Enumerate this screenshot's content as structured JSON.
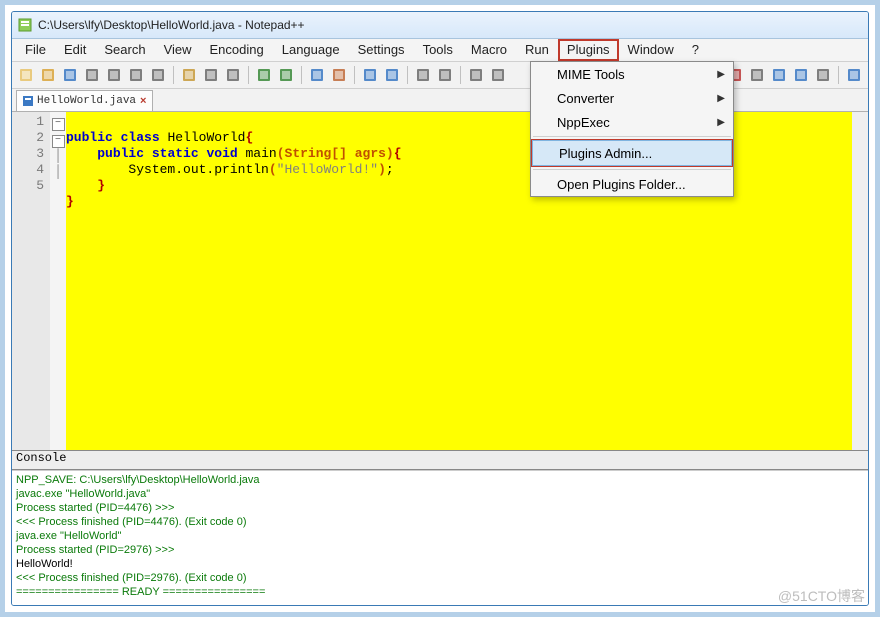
{
  "window": {
    "title": "C:\\Users\\lfy\\Desktop\\HelloWorld.java - Notepad++"
  },
  "menu": {
    "items": [
      {
        "label": "File"
      },
      {
        "label": "Edit"
      },
      {
        "label": "Search"
      },
      {
        "label": "View"
      },
      {
        "label": "Encoding"
      },
      {
        "label": "Language"
      },
      {
        "label": "Settings"
      },
      {
        "label": "Tools"
      },
      {
        "label": "Macro"
      },
      {
        "label": "Run"
      },
      {
        "label": "Plugins",
        "open": true,
        "highlight": true
      },
      {
        "label": "Window"
      },
      {
        "label": "?"
      }
    ]
  },
  "dropdown": {
    "items": [
      {
        "label": "MIME Tools",
        "submenu": true
      },
      {
        "label": "Converter",
        "submenu": true
      },
      {
        "label": "NppExec",
        "submenu": true
      },
      {
        "sep": true
      },
      {
        "label": "Plugins Admin...",
        "highlight": true,
        "hover": true
      },
      {
        "sep": true
      },
      {
        "label": "Open Plugins Folder..."
      }
    ]
  },
  "tab": {
    "name": "HelloWorld.java"
  },
  "code": {
    "lines": [
      "1",
      "2",
      "3",
      "4",
      "5"
    ],
    "l1": {
      "kw1": "public",
      "kw2": "class",
      "nm": "HelloWorld",
      "br": "{"
    },
    "l2": {
      "kw1": "public",
      "kw2": "static",
      "kw3": "void",
      "nm": "main",
      "p": "(String[] agrs)",
      "br": "{"
    },
    "l3": {
      "call": "System.out.println",
      "p": "(",
      "str": "\"HelloWorld!\"",
      "p2": ")",
      "sc": ";"
    },
    "l4": {
      "br": "}"
    },
    "l5": {
      "br": "}"
    }
  },
  "console": {
    "title": "Console",
    "lines": [
      {
        "cls": "cg",
        "t": "NPP_SAVE: C:\\Users\\lfy\\Desktop\\HelloWorld.java"
      },
      {
        "cls": "cg",
        "t": "javac.exe \"HelloWorld.java\""
      },
      {
        "cls": "cg",
        "t": "Process started (PID=4476) >>>"
      },
      {
        "cls": "cg",
        "t": "<<< Process finished (PID=4476). (Exit code 0)"
      },
      {
        "cls": "cg",
        "t": "java.exe \"HelloWorld\""
      },
      {
        "cls": "cg",
        "t": "Process started (PID=2976) >>>"
      },
      {
        "cls": "ck",
        "t": "HelloWorld!"
      },
      {
        "cls": "cg",
        "t": "<<< Process finished (PID=2976). (Exit code 0)"
      },
      {
        "cls": "cg",
        "t": "================ READY ================"
      }
    ]
  },
  "toolbar_icons": [
    {
      "n": "new-file-icon",
      "c": "#e7c36a"
    },
    {
      "n": "open-file-icon",
      "c": "#d9a43b"
    },
    {
      "n": "save-icon",
      "c": "#3a78c3"
    },
    {
      "n": "save-all-icon",
      "c": "#6a6a6a"
    },
    {
      "n": "close-icon",
      "c": "#6a6a6a"
    },
    {
      "n": "close-all-icon",
      "c": "#6a6a6a"
    },
    {
      "n": "print-icon",
      "c": "#6a6a6a"
    },
    {
      "sep": true
    },
    {
      "n": "cut-icon",
      "c": "#c79a3a"
    },
    {
      "n": "copy-icon",
      "c": "#6a6a6a"
    },
    {
      "n": "paste-icon",
      "c": "#6a6a6a"
    },
    {
      "sep": true
    },
    {
      "n": "undo-icon",
      "c": "#3a8a3a"
    },
    {
      "n": "redo-icon",
      "c": "#3a8a3a"
    },
    {
      "sep": true
    },
    {
      "n": "find-icon",
      "c": "#3a78c3"
    },
    {
      "n": "replace-icon",
      "c": "#c06a3a"
    },
    {
      "sep": true
    },
    {
      "n": "zoom-in-icon",
      "c": "#3a78c3"
    },
    {
      "n": "zoom-out-icon",
      "c": "#3a78c3"
    },
    {
      "sep": true
    },
    {
      "n": "sync-v-icon",
      "c": "#6a6a6a"
    },
    {
      "n": "sync-h-icon",
      "c": "#6a6a6a"
    },
    {
      "sep": true
    },
    {
      "n": "wrap-icon",
      "c": "#6a6a6a"
    },
    {
      "n": "chars-icon",
      "c": "#6a6a6a"
    },
    {
      "gap": true
    },
    {
      "n": "record-icon",
      "c": "#c03a3a"
    },
    {
      "n": "stop-icon",
      "c": "#6a6a6a"
    },
    {
      "n": "play-icon",
      "c": "#3a78c3"
    },
    {
      "n": "playm-icon",
      "c": "#3a78c3"
    },
    {
      "n": "savem-icon",
      "c": "#6a6a6a"
    },
    {
      "sep": true
    },
    {
      "n": "monitor-icon",
      "c": "#3a78c3"
    }
  ],
  "watermark": "@51CTO博客"
}
